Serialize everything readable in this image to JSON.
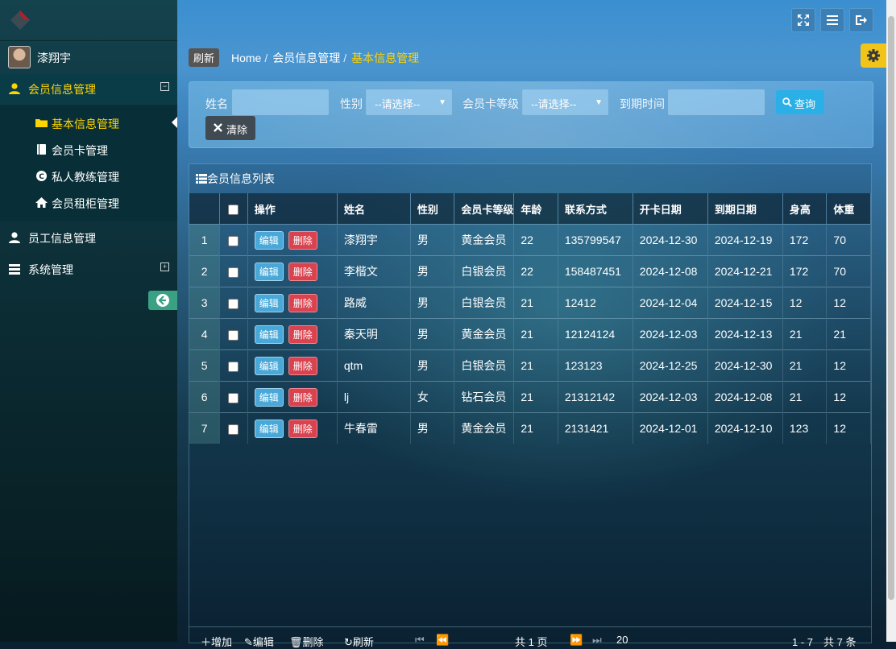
{
  "sidebar": {
    "user_name": "漆翔宇",
    "groups": [
      {
        "label": "会员信息管理",
        "toggle": "−"
      },
      {
        "label": "员工信息管理"
      },
      {
        "label": "系统管理",
        "toggle": "+"
      }
    ],
    "sub_items": [
      {
        "label": "基本信息管理"
      },
      {
        "label": "会员卡管理"
      },
      {
        "label": "私人教练管理"
      },
      {
        "label": "会员租柜管理"
      }
    ]
  },
  "breadcrumb": {
    "refresh": "刷新",
    "items": [
      "Home",
      "会员信息管理",
      "基本信息管理"
    ]
  },
  "search": {
    "name_label": "姓名",
    "gender_label": "性别",
    "gender_value": "--请选择--",
    "card_level_label": "会员卡等级",
    "card_level_value": "--请选择--",
    "expire_label": "到期时间",
    "query_button": "查询",
    "clear_button": "清除"
  },
  "list": {
    "title": "会员信息列表",
    "columns": [
      "操作",
      "姓名",
      "性别",
      "会员卡等级",
      "年龄",
      "联系方式",
      "开卡日期",
      "到期日期",
      "身高",
      "体重"
    ],
    "edit_label": "编辑",
    "delete_label": "删除",
    "rows": [
      {
        "no": "1",
        "name": "漆翔宇",
        "gender": "男",
        "card": "黄金会员",
        "age": "22",
        "phone": "135799547",
        "open": "2024-12-30",
        "expire": "2024-12-19",
        "height": "172",
        "weight": "70"
      },
      {
        "no": "2",
        "name": "李楷文",
        "gender": "男",
        "card": "白银会员",
        "age": "22",
        "phone": "158487451",
        "open": "2024-12-08",
        "expire": "2024-12-21",
        "height": "172",
        "weight": "70"
      },
      {
        "no": "3",
        "name": "路威",
        "gender": "男",
        "card": "白银会员",
        "age": "21",
        "phone": "12412",
        "open": "2024-12-04",
        "expire": "2024-12-15",
        "height": "12",
        "weight": "12"
      },
      {
        "no": "4",
        "name": "秦天明",
        "gender": "男",
        "card": "黄金会员",
        "age": "21",
        "phone": "12124124",
        "open": "2024-12-03",
        "expire": "2024-12-13",
        "height": "21",
        "weight": "21"
      },
      {
        "no": "5",
        "name": "qtm",
        "gender": "男",
        "card": "白银会员",
        "age": "21",
        "phone": "123123",
        "open": "2024-12-25",
        "expire": "2024-12-30",
        "height": "21",
        "weight": "12"
      },
      {
        "no": "6",
        "name": "lj",
        "gender": "女",
        "card": "钻石会员",
        "age": "21",
        "phone": "21312142",
        "open": "2024-12-03",
        "expire": "2024-12-08",
        "height": "21",
        "weight": "12"
      },
      {
        "no": "7",
        "name": "牛春雷",
        "gender": "男",
        "card": "黄金会员",
        "age": "21",
        "phone": "2131421",
        "open": "2024-12-01",
        "expire": "2024-12-10",
        "height": "123",
        "weight": "12"
      }
    ]
  },
  "pager": {
    "add": "增加",
    "edit": "编辑",
    "delete": "删除",
    "refresh": "刷新",
    "page_text": "共 1 页",
    "page_size": "20",
    "summary": "1 - 7　共 7 条"
  },
  "colors": {
    "accent": "#ffd400",
    "edit": "#4aa8d8",
    "delete": "#d8434f",
    "query": "#2ab0e6"
  }
}
